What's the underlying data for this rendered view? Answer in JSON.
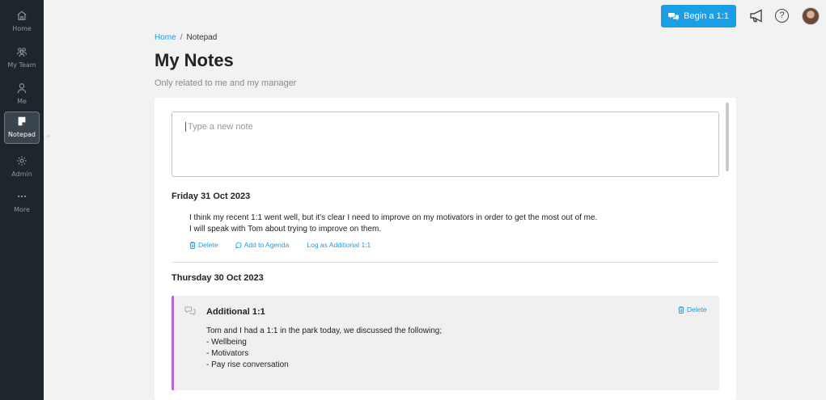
{
  "sidebar": {
    "items": [
      {
        "label": "Home",
        "icon": "home-icon"
      },
      {
        "label": "My Team",
        "icon": "team-icon"
      },
      {
        "label": "Me",
        "icon": "user-icon"
      },
      {
        "label": "Notepad",
        "icon": "notepad-icon",
        "active": true
      },
      {
        "label": "Admin",
        "icon": "gear-icon"
      },
      {
        "label": "More",
        "icon": "more-dots-icon"
      }
    ],
    "marker": "≡"
  },
  "topbar": {
    "begin_label": "Begin a 1:1",
    "help_glyph": "?"
  },
  "breadcrumb": {
    "home": "Home",
    "separator": "/",
    "current": "Notepad"
  },
  "page": {
    "title": "My Notes",
    "subtitle": "Only related to me and my manager"
  },
  "new_note": {
    "placeholder": "Type a new note"
  },
  "entries": [
    {
      "date": "Friday 31 Oct 2023",
      "lines": [
        "I think my recent 1:1 went well, but it's clear I need to improve on my motivators in order to get the most out of me.",
        "I will speak with Tom about trying to improve on them."
      ],
      "actions": {
        "delete": "Delete",
        "add_to_agenda": "Add to Agenda",
        "log_additional": "Log as Additional 1:1"
      }
    },
    {
      "date": "Thursday 30 Oct 2023",
      "card": {
        "title": "Additional 1:1",
        "delete": "Delete",
        "lines": [
          "Tom and I had a 1:1 in the park today, we discussed the following;",
          "- Wellbeing",
          "- Motivators",
          "- Pay rise conversation"
        ]
      }
    }
  ],
  "colors": {
    "accent": "#1a9ee6",
    "sidebar_bg": "#1e252b",
    "additional_border": "#b866d9"
  }
}
